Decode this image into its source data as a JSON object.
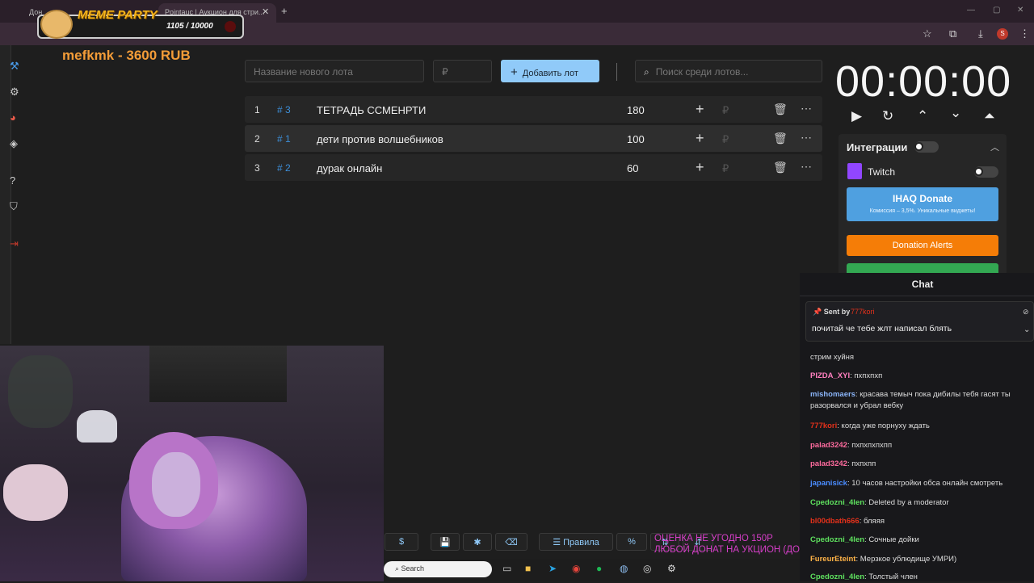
{
  "browser": {
    "active_tab": "Pointauc | Аукцион для стри...",
    "left_tab": "Дон",
    "tab_close": "✕",
    "new_tab": "+",
    "profile_letter": "S"
  },
  "overlay": {
    "title": "MEME PARTY",
    "progress_text": "1105 / 10000",
    "progress_value": 1105,
    "progress_max": 10000
  },
  "leader": "mefkmk - 3600 RUB",
  "controls": {
    "lot_name_placeholder": "Название нового лота",
    "price_placeholder": "₽",
    "add_button": "Добавить лот",
    "search_placeholder": "Поиск среди лотов..."
  },
  "lots": [
    {
      "index": "1",
      "id": "# 3",
      "name": "ТЕТРАДЬ ССМЕНРТИ",
      "amount": "180"
    },
    {
      "index": "2",
      "id": "# 1",
      "name": "дети против волшебников",
      "amount": "100"
    },
    {
      "index": "3",
      "id": "# 2",
      "name": "дурак онлайн",
      "amount": "60"
    }
  ],
  "lot_currency": "₽",
  "timer": "00:00:00",
  "integrations": {
    "title": "Интеграции",
    "twitch": "Twitch",
    "ihaq_title": "IHAQ Donate",
    "ihaq_sub": "Комиссия – 3,5%. Уникальные виджеты!",
    "donation_alerts": "Donation Alerts"
  },
  "chat": {
    "title": "Chat",
    "pinned_label": "Sent by",
    "pinned_user": "777kori",
    "pinned_message": "почитай че тебе жлт написал блять",
    "messages": [
      {
        "user": "",
        "text": "стрим хуйня",
        "color": "#cccccc"
      },
      {
        "user": "PIZDA_XYI",
        "text": ": пхпхпхп",
        "color": "#ff7fbf"
      },
      {
        "user": "mishomaers",
        "text": ": красава темыч пока дибилы тебя гасят ты разорвался и убрал вебку",
        "color": "#8ab4f8"
      },
      {
        "user": "777kori",
        "text": ": когда уже порнуху ждать",
        "color": "#e3311b"
      },
      {
        "user": "palad3242",
        "text": ": пхпхпхпхпп",
        "color": "#ff6b9e"
      },
      {
        "user": "palad3242",
        "text": ": пхпхпп",
        "color": "#ff6b9e"
      },
      {
        "user": "japanisick",
        "text": ": 10 часов настройки обса онлайн смотреть",
        "color": "#4a8cff"
      },
      {
        "user": "Cpedozni_4len",
        "text": ": Deleted by a moderator",
        "color": "#5ee05e"
      },
      {
        "user": "bl00dbath666",
        "text": ": бляяя",
        "color": "#e3311b"
      },
      {
        "user": "Cpedozni_4len",
        "text": ": Сочные дойки",
        "color": "#5ee05e"
      },
      {
        "user": "FureurEteint",
        "text": ": Мерзкое ублюдище УМРИ)",
        "color": "#ffb347"
      },
      {
        "user": "Cpedozni_4len",
        "text": ": Толстый член",
        "color": "#5ee05e"
      }
    ]
  },
  "bottom": {
    "rules": "Правила",
    "percent": "%",
    "overlay_line1": "ОЦЕНКА НЕ УГОДНО 150Р",
    "overlay_line2": "ЛЮБОЙ ДОНАТ НА УКЦИОН (ДО"
  },
  "taskbar": {
    "search": "Search"
  }
}
